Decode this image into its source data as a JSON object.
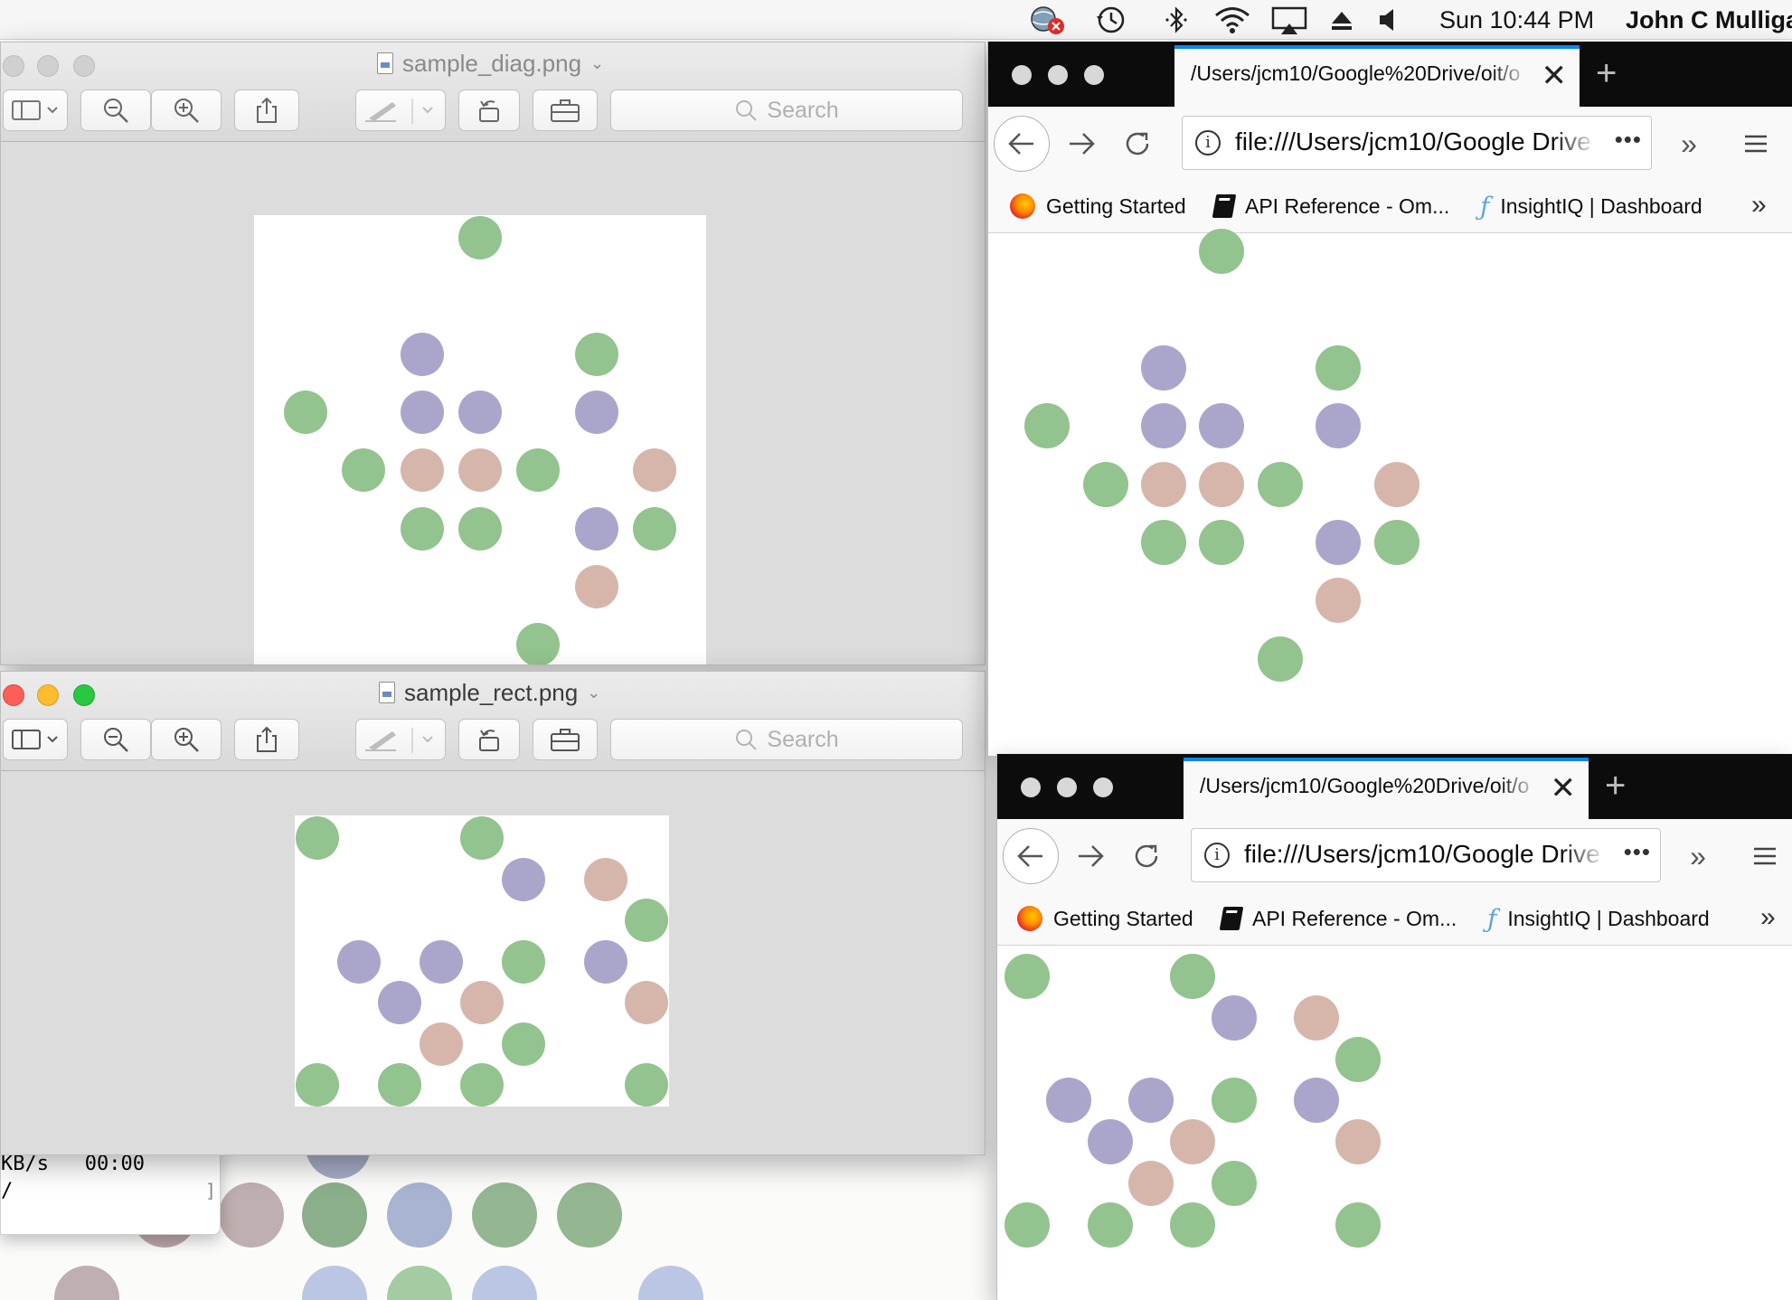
{
  "menubar": {
    "clock": "Sun 10:44 PM",
    "user": "John C Mulliga"
  },
  "colors": {
    "green": "#93c38e",
    "purple": "#aaa6cb",
    "pink": "#d6b6ab",
    "firefox_accent": "#0a84ff",
    "tabstrip": "#0c0c0d"
  },
  "preview_diag": {
    "filename": "sample_diag.png",
    "search_placeholder": "Search",
    "dots": [
      {
        "c": "green",
        "col": 3.5,
        "row": 0
      },
      {
        "c": "purple",
        "col": 2.5,
        "row": 2
      },
      {
        "c": "green",
        "col": 5.5,
        "row": 2
      },
      {
        "c": "green",
        "col": 0.5,
        "row": 3
      },
      {
        "c": "purple",
        "col": 2.5,
        "row": 3
      },
      {
        "c": "purple",
        "col": 3.5,
        "row": 3
      },
      {
        "c": "purple",
        "col": 5.5,
        "row": 3
      },
      {
        "c": "green",
        "col": 1.5,
        "row": 4
      },
      {
        "c": "pink",
        "col": 2.5,
        "row": 4
      },
      {
        "c": "pink",
        "col": 3.5,
        "row": 4
      },
      {
        "c": "green",
        "col": 4.5,
        "row": 4
      },
      {
        "c": "pink",
        "col": 6.5,
        "row": 4
      },
      {
        "c": "green",
        "col": 2.5,
        "row": 5
      },
      {
        "c": "green",
        "col": 3.5,
        "row": 5
      },
      {
        "c": "purple",
        "col": 5.5,
        "row": 5
      },
      {
        "c": "green",
        "col": 6.5,
        "row": 5
      },
      {
        "c": "pink",
        "col": 5.5,
        "row": 6
      },
      {
        "c": "green",
        "col": 4.5,
        "row": 7
      }
    ]
  },
  "preview_rect": {
    "filename": "sample_rect.png",
    "search_placeholder": "Search",
    "dots": [
      {
        "c": "green",
        "col": 0,
        "row": 0
      },
      {
        "c": "green",
        "col": 2,
        "row": 0
      },
      {
        "c": "purple",
        "col": 2.5,
        "row": 0.5
      },
      {
        "c": "pink",
        "col": 3.5,
        "row": 0.5
      },
      {
        "c": "green",
        "col": 4,
        "row": 1
      },
      {
        "c": "purple",
        "col": 0.5,
        "row": 1.5
      },
      {
        "c": "purple",
        "col": 1.5,
        "row": 1.5
      },
      {
        "c": "green",
        "col": 2.5,
        "row": 1.5
      },
      {
        "c": "purple",
        "col": 3.5,
        "row": 1.5
      },
      {
        "c": "purple",
        "col": 1,
        "row": 2
      },
      {
        "c": "pink",
        "col": 2,
        "row": 2
      },
      {
        "c": "pink",
        "col": 4,
        "row": 2
      },
      {
        "c": "pink",
        "col": 1.5,
        "row": 2.5
      },
      {
        "c": "green",
        "col": 2.5,
        "row": 2.5
      },
      {
        "c": "green",
        "col": 0,
        "row": 3
      },
      {
        "c": "green",
        "col": 1,
        "row": 3
      },
      {
        "c": "green",
        "col": 2,
        "row": 3
      },
      {
        "c": "green",
        "col": 4,
        "row": 3
      }
    ]
  },
  "firefox1": {
    "tab_title": "/Users/jcm10/Google%20Drive/oit/o",
    "url": "file:///Users/jcm10/Google Drive",
    "bookmarks": [
      "Getting Started",
      "API Reference - Om...",
      "InsightIQ | Dashboard"
    ]
  },
  "firefox2": {
    "tab_title": "/Users/jcm10/Google%20Drive/oit/o",
    "url": "file:///Users/jcm10/Google Drive",
    "bookmarks": [
      "Getting Started",
      "API Reference - Om...",
      "InsightIQ | Dashboard"
    ]
  },
  "terminal": {
    "line1": "KB/s   00:00",
    "line2": "/",
    "bracket": "]"
  }
}
